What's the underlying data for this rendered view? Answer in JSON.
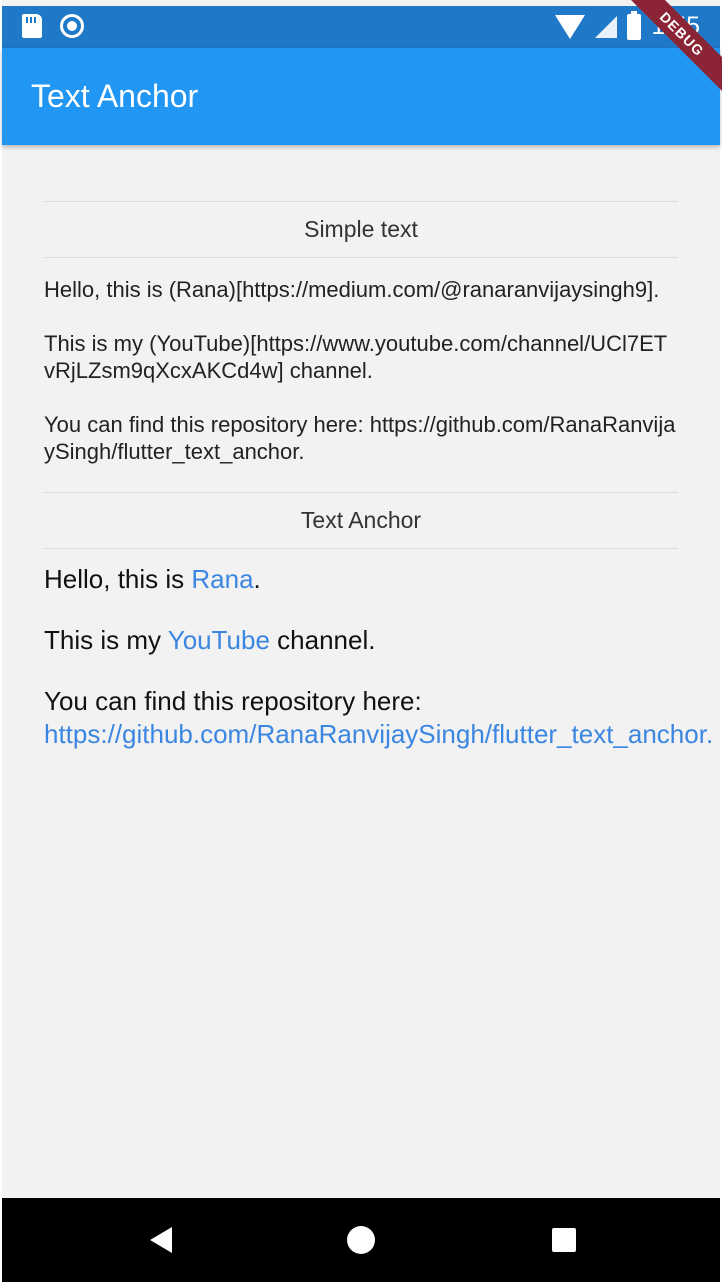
{
  "status_bar": {
    "time": "1:55"
  },
  "app_bar": {
    "title": "Text Anchor",
    "debug_label": "DEBUG"
  },
  "simple_section": {
    "header": "Simple text",
    "lines": [
      "Hello, this is (Rana)[https://medium.com/@ranaranvijaysingh9].",
      "This is my (YouTube)[https://www.youtube.com/channel/UCl7ETvRjLZsm9qXcxAKCd4w] channel.",
      "You can find this repository here: https://github.com/RanaRanvijaySingh/flutter_text_anchor."
    ]
  },
  "anchor_section": {
    "header": "Text Anchor",
    "line1": {
      "prefix": "Hello, this is ",
      "link": "Rana",
      "suffix": "."
    },
    "line2": {
      "prefix": "This is my ",
      "link": "YouTube",
      "suffix": " channel."
    },
    "line3": {
      "prefix": "You can find this repository here: ",
      "link": "https://github.com/RanaRanvijaySingh/flutter_text_anchor."
    }
  },
  "colors": {
    "app_bar": "#2196f3",
    "status_bar": "#1f78c8",
    "link": "#3b86e0",
    "debug": "#8b2434"
  },
  "icons": [
    "sd-card-icon",
    "circle-notification-icon",
    "wifi-icon",
    "signal-icon",
    "battery-icon",
    "back-icon",
    "home-icon",
    "recents-icon"
  ]
}
